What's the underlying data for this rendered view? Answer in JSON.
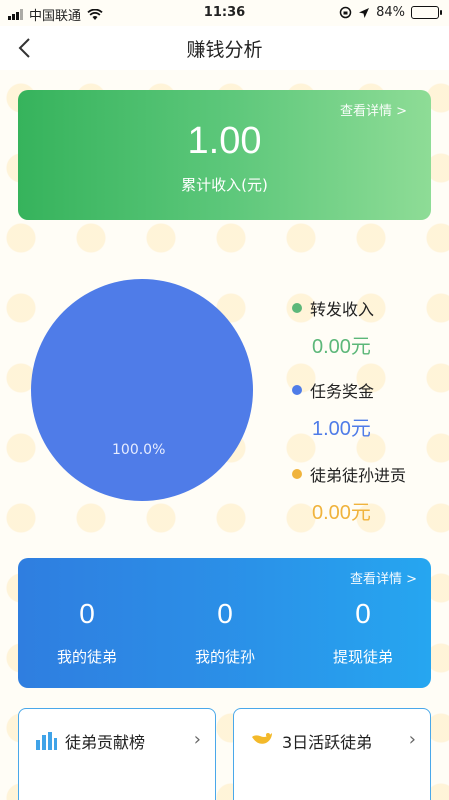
{
  "status_bar": {
    "carrier": "中国联通",
    "time": "11:36",
    "battery_percent": "84%",
    "battery_level": 0.84
  },
  "nav": {
    "title": "赚钱分析",
    "back_icon": "chevron-left-icon"
  },
  "income_card": {
    "detail_link": "查看详情 >",
    "amount": "1.00",
    "caption": "累计收入(元)",
    "colors": [
      "#36b35c",
      "#8edc96"
    ]
  },
  "chart_data": {
    "type": "pie",
    "slices": [
      {
        "name": "转发收入",
        "value": 0.0,
        "color": "#5cb779"
      },
      {
        "name": "任务奖金",
        "value": 1.0,
        "color": "#4f7ce8"
      },
      {
        "name": "徒弟徒孙进贡",
        "value": 0.0,
        "color": "#f0b33c"
      }
    ],
    "data_labels": [
      "100.0%"
    ]
  },
  "legend": [
    {
      "label": "转发收入",
      "value": "0.00元",
      "color": "#5cb779"
    },
    {
      "label": "任务奖金",
      "value": "1.00元",
      "color": "#4f7ce8"
    },
    {
      "label": "徒弟徒孙进贡",
      "value": "0.00元",
      "color": "#f0b33c"
    }
  ],
  "team_card": {
    "detail_link": "查看详情 >",
    "stats": [
      {
        "value": "0",
        "label": "我的徒弟"
      },
      {
        "value": "0",
        "label": "我的徒孙"
      },
      {
        "value": "0",
        "label": "提现徒弟"
      }
    ]
  },
  "rank_cards": [
    {
      "title": "徒弟贡献榜",
      "icon": "bar-chart-icon"
    },
    {
      "title": "3日活跃徒弟",
      "icon": "bird-icon"
    }
  ]
}
